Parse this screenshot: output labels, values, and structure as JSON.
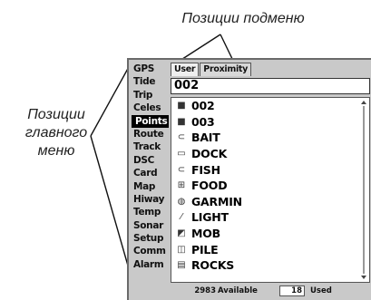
{
  "captions": {
    "submenu": "Позиции подменю",
    "main_menu": [
      "Позиции",
      "главного",
      "меню"
    ]
  },
  "main_menu": {
    "items": [
      {
        "label": "GPS",
        "id": "gps"
      },
      {
        "label": "Tide",
        "id": "tide"
      },
      {
        "label": "Trip",
        "id": "trip"
      },
      {
        "label": "Celes",
        "id": "celes"
      },
      {
        "label": "Points",
        "id": "points",
        "selected": true
      },
      {
        "label": "Route",
        "id": "route"
      },
      {
        "label": "Track",
        "id": "track"
      },
      {
        "label": "DSC",
        "id": "dsc"
      },
      {
        "label": "Card",
        "id": "card"
      },
      {
        "label": "Map",
        "id": "map"
      },
      {
        "label": "Hiway",
        "id": "hiway"
      },
      {
        "label": "Temp",
        "id": "temp"
      },
      {
        "label": "Sonar",
        "id": "sonar"
      },
      {
        "label": "Setup",
        "id": "setup"
      },
      {
        "label": "Comm",
        "id": "comm"
      },
      {
        "label": "Alarm",
        "id": "alarm"
      }
    ]
  },
  "submenu": {
    "tabs": [
      {
        "label": "User",
        "id": "user",
        "selected": true
      },
      {
        "label": "Proximity",
        "id": "proximity"
      }
    ]
  },
  "search": {
    "value": "002"
  },
  "waypoints": [
    {
      "name": "002",
      "icon": "square-icon",
      "glyph": "■"
    },
    {
      "name": "003",
      "icon": "square-icon",
      "glyph": "■"
    },
    {
      "name": "BAIT",
      "icon": "fish-hook-icon",
      "glyph": "⊂"
    },
    {
      "name": "DOCK",
      "icon": "dock-icon",
      "glyph": "▭"
    },
    {
      "name": "FISH",
      "icon": "fish-icon",
      "glyph": "⊂"
    },
    {
      "name": "FOOD",
      "icon": "food-icon",
      "glyph": "⊞"
    },
    {
      "name": "GARMIN",
      "icon": "garmin-icon",
      "glyph": "◍"
    },
    {
      "name": "LIGHT",
      "icon": "light-icon",
      "glyph": "⁄"
    },
    {
      "name": "MOB",
      "icon": "mob-icon",
      "glyph": "◩"
    },
    {
      "name": "PILE",
      "icon": "pile-icon",
      "glyph": "◫"
    },
    {
      "name": "ROCKS",
      "icon": "rocks-icon",
      "glyph": "▤"
    }
  ],
  "status": {
    "available_count": "2983",
    "available_label": "Available",
    "used_count": "18",
    "used_label": "Used"
  }
}
